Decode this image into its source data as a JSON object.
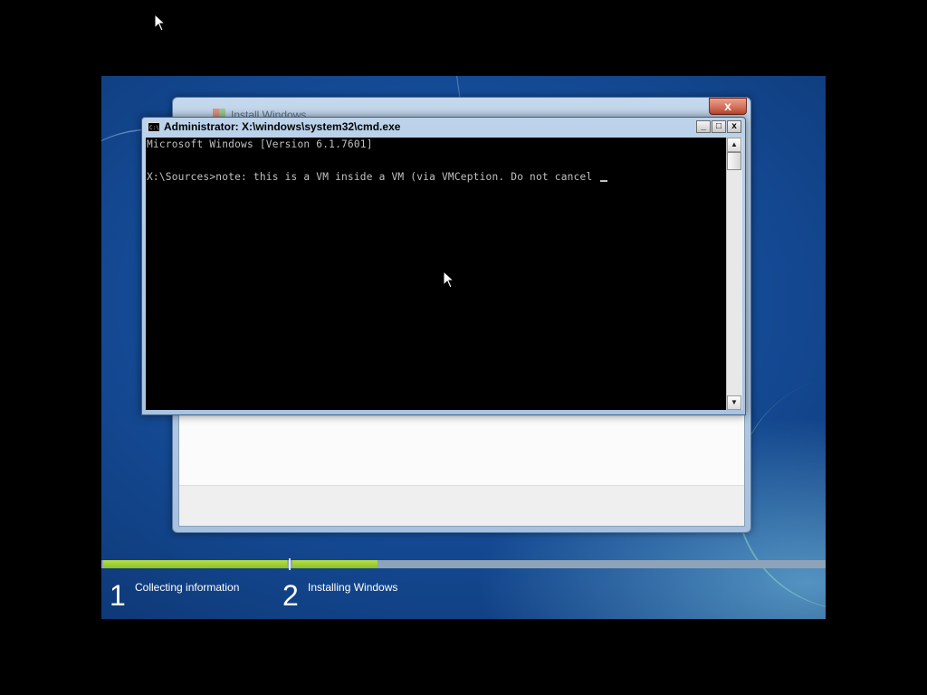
{
  "host": {
    "cursor_icon": "arrow-cursor-icon"
  },
  "install_window": {
    "title": "Install Windows",
    "close_label": "x"
  },
  "cmd_window": {
    "title": "Administrator: X:\\windows\\system32\\cmd.exe",
    "icon_text": "C:\\",
    "buttons": {
      "minimize": "_",
      "maximize": "□",
      "close": "x"
    },
    "console_lines": [
      "Microsoft Windows [Version 6.1.7601]",
      "",
      "X:\\Sources>note: this is a VM inside a VM (via VMCeption. Do not cancel "
    ],
    "scroll_up": "▲",
    "scroll_down": "▼"
  },
  "setup_progress": {
    "steps": [
      {
        "number": "1",
        "label": "Collecting information"
      },
      {
        "number": "2",
        "label": "Installing Windows"
      }
    ],
    "colors": {
      "complete": "#8cc121",
      "track": "#8fa3b8"
    }
  }
}
